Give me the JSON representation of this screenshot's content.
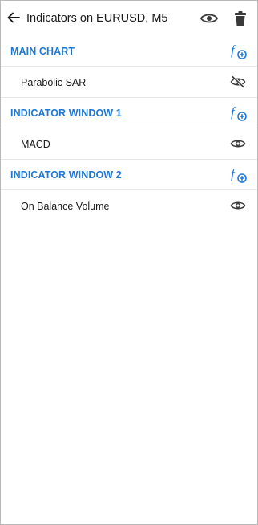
{
  "header": {
    "title": "Indicators on EURUSD, M5",
    "icons": [
      "arrow-left-icon",
      "eye-icon",
      "trash-icon"
    ]
  },
  "sections": [
    {
      "title": "MAIN CHART",
      "add_icon": "function-add-icon",
      "indicators": [
        {
          "label": "Parabolic SAR",
          "visibility_icon": "eye-off-icon"
        }
      ]
    },
    {
      "title": "INDICATOR WINDOW 1",
      "add_icon": "function-add-icon",
      "indicators": [
        {
          "label": "MACD",
          "visibility_icon": "eye-icon"
        }
      ]
    },
    {
      "title": "INDICATOR WINDOW 2",
      "add_icon": "function-add-icon",
      "indicators": [
        {
          "label": "On Balance Volume",
          "visibility_icon": "eye-icon"
        }
      ]
    }
  ],
  "colors": {
    "accent": "#1f7ad6",
    "text": "#1a1a1a",
    "icon": "#3a3a3a",
    "divider": "#e6e6e6"
  }
}
